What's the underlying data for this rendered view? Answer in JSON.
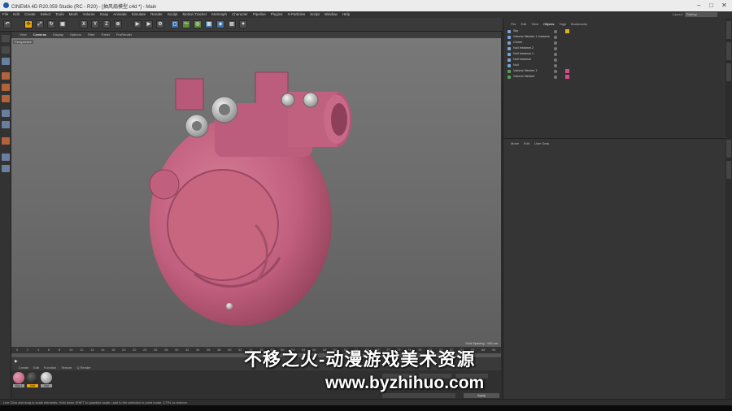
{
  "window": {
    "title": "CINEMA 4D R20.059 Studio (RC - R20) - [抽风扇模型.c4d *] - Main"
  },
  "menubar": {
    "items": [
      "File",
      "Edit",
      "Create",
      "Select",
      "Tools",
      "Mesh",
      "Volume",
      "Snap",
      "Animate",
      "Simulate",
      "Render",
      "Sculpt",
      "Motion Tracker",
      "MoGraph",
      "Character",
      "Pipeline",
      "Plugins",
      "X-Particles",
      "Script",
      "Window",
      "Help"
    ],
    "layout_label": "Layout:",
    "layout_value": "Startup"
  },
  "toolbar": {
    "axis_x": "X",
    "axis_y": "Y",
    "axis_z": "Z"
  },
  "viewport": {
    "menu": [
      "View",
      "Cameras",
      "Display",
      "Options",
      "Filter",
      "Panel",
      "ProRender"
    ],
    "label": "Perspective",
    "grid_spacing": "Grid Spacing : 100 cm"
  },
  "timeline": {
    "ticks": [
      "0",
      "2",
      "4",
      "6",
      "8",
      "10",
      "12",
      "14",
      "16",
      "18",
      "20",
      "22",
      "24",
      "26",
      "28",
      "30",
      "32",
      "34",
      "36",
      "38",
      "40",
      "42",
      "44",
      "46",
      "48",
      "50",
      "52",
      "54",
      "56",
      "58",
      "60",
      "62",
      "64",
      "66",
      "68",
      "70",
      "72",
      "74",
      "76",
      "78",
      "80",
      "82",
      "84",
      "86",
      "88",
      "90"
    ]
  },
  "materials": {
    "menu": [
      "Create",
      "Edit",
      "Function",
      "Texture",
      "Q Render"
    ],
    "items": [
      {
        "name": "Mat.1",
        "color": "#c05a7e"
      },
      {
        "name": "Mat",
        "color": "#2a2a2a"
      },
      {
        "name": "Mat",
        "color": "#9a9a9a"
      }
    ]
  },
  "objects": {
    "menu": [
      "File",
      "Edit",
      "View",
      "Objects",
      "Tags",
      "Bookmarks"
    ],
    "rows": [
      "Sky",
      "Volume Mesher 1 Instance",
      "Cloner",
      "Null Instance.2",
      "Null Instance.1",
      "Null Instance",
      "Null",
      "Volume Mesher 1",
      "Volume Mesher"
    ]
  },
  "attributes": {
    "menu": [
      "Mode",
      "Edit",
      "User Data"
    ]
  },
  "statusbar": {
    "text": "Live Click and drag to scale elements. Hold down SHIFT to quantize scale / add to the selection in point mode, CTRL to remove."
  },
  "apply_button": "Apply",
  "watermark": {
    "line1": "不移之火-动漫游戏美术资源",
    "line2": "www.byzhihuo.com"
  },
  "colors": {
    "model": "#c8607e",
    "accent": "#f0a500"
  }
}
